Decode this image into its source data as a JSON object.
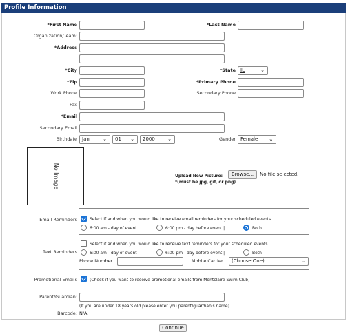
{
  "header": {
    "title": "Profile Information"
  },
  "fields": {
    "first_name": "*First Name",
    "last_name": "*Last Name",
    "organization": "Organization/Team:",
    "address": "*Address",
    "city": "*City",
    "state": "*State",
    "state_value": "IL",
    "zip": "*Zip",
    "primary_phone": "*Primary Phone",
    "work_phone": "Work Phone",
    "secondary_phone": "Secondary Phone",
    "fax": "Fax",
    "email": "*Email",
    "secondary_email": "Secondary Email",
    "birthdate": "Birthdate",
    "birth_month": "Jan",
    "birth_day": "01",
    "birth_year": "2000",
    "gender": "Gender",
    "gender_value": "Female"
  },
  "photo": {
    "placeholder": "No Image",
    "upload_label": "Upload New Picture:",
    "browse_button": "Browse...",
    "file_status": "No file selected.",
    "format_note": "*(must be jpg, gif, or png)"
  },
  "email_reminders": {
    "label": "Email Reminders",
    "description": "Select if and when you would like to receive email reminders for your scheduled events.",
    "options": [
      "6:00 am - day of event |",
      "6:00 pm - day before event |",
      "Both"
    ],
    "selected": "Both"
  },
  "text_reminders": {
    "label": "Text Reminders",
    "description": "Select if and when you would like to receive text reminders for your scheduled events.",
    "options": [
      "6:00 am - day of event |",
      "6:00 pm - day before event |",
      "Both"
    ],
    "phone_label": "Phone Number",
    "carrier_label": "Mobile Carrier",
    "carrier_value": "(Choose One)"
  },
  "promotional": {
    "label": "Promotional Emails",
    "description": "(Check if you want to receive promotional emails from Montclaire Swim Club)"
  },
  "guardian": {
    "label": "Parent/Guardian:",
    "note": "(If you are under 18 years old please enter you parent/guardian's name)"
  },
  "barcode": {
    "label": "Barcode:",
    "value": "N/A"
  },
  "actions": {
    "continue": "Continue"
  },
  "colors": {
    "header_bg": "#1b3f7a",
    "accent": "#1a73d6"
  }
}
